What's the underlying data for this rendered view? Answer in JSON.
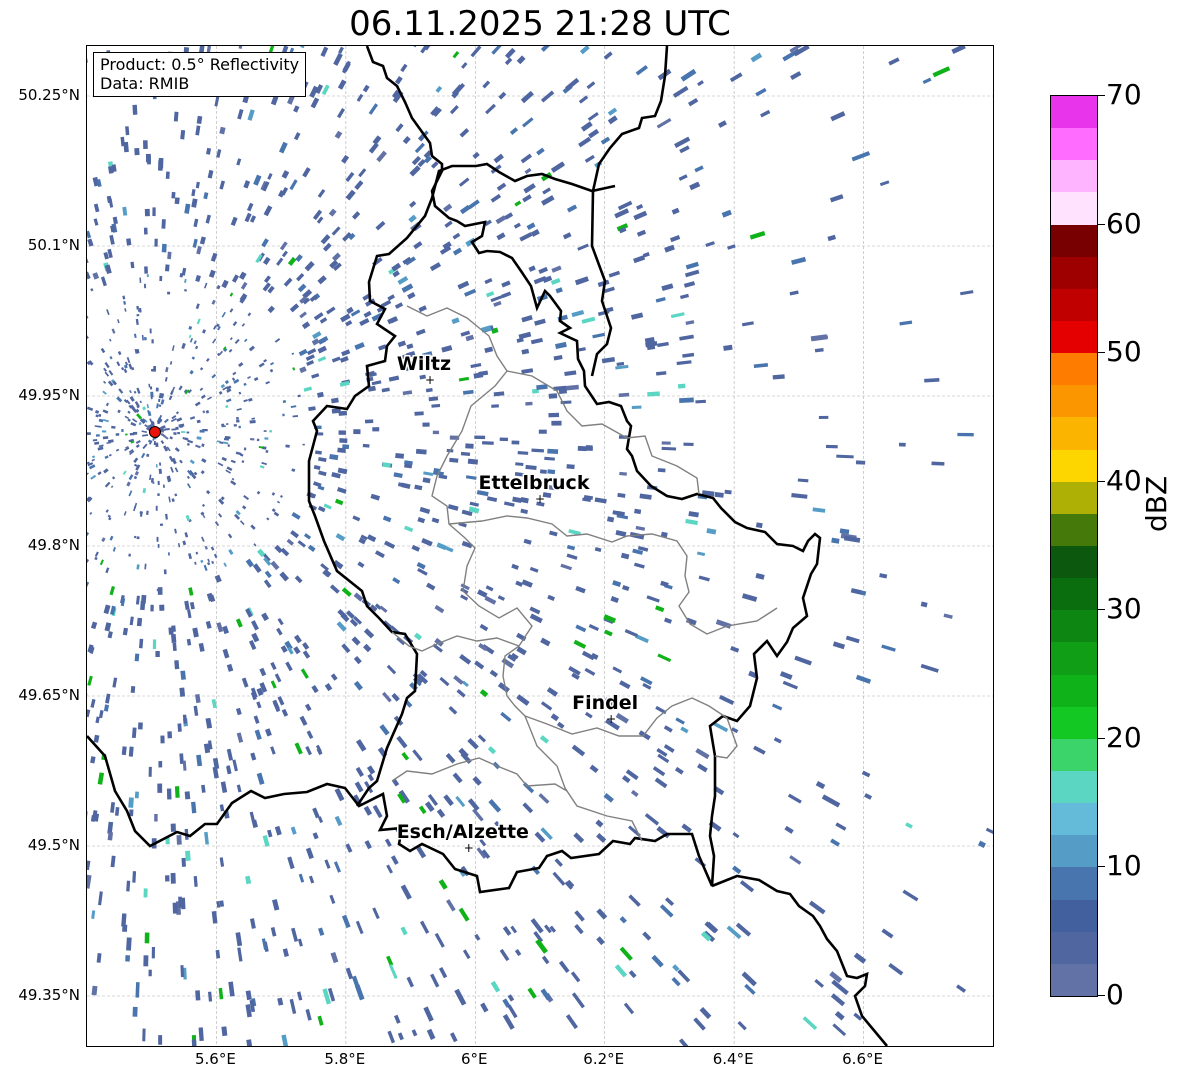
{
  "title": "06.11.2025 21:28 UTC",
  "info_box": {
    "product": "Product: 0.5° Reflectivity",
    "data_source": "Data: RMIB"
  },
  "axes": {
    "lat_ticks": [
      "50.25°N",
      "50.1°N",
      "49.95°N",
      "49.8°N",
      "49.65°N",
      "49.5°N",
      "49.35°N"
    ],
    "lon_ticks": [
      "5.6°E",
      "5.8°E",
      "6°E",
      "6.2°E",
      "6.4°E",
      "6.6°E"
    ]
  },
  "cities": [
    {
      "name": "Wiltz",
      "lon": 5.93,
      "lat": 49.966
    },
    {
      "name": "Ettelbruck",
      "lon": 6.1,
      "lat": 49.847
    },
    {
      "name": "Findel",
      "lon": 6.21,
      "lat": 49.627
    },
    {
      "name": "Esch/Alzette",
      "lon": 5.99,
      "lat": 49.498
    }
  ],
  "radar_site": {
    "lon": 5.505,
    "lat": 49.914,
    "color": "#e8140c"
  },
  "colorbar": {
    "title": "dBZ",
    "min": 0,
    "max": 70,
    "tick_labels": [
      "0",
      "10",
      "20",
      "30",
      "40",
      "50",
      "60",
      "70"
    ],
    "colors": [
      "#6272a6",
      "#5066a0",
      "#42609e",
      "#4875ae",
      "#559dc7",
      "#64bbd9",
      "#5bd6c2",
      "#3bd46a",
      "#13c822",
      "#10b21a",
      "#0f9e16",
      "#0d8612",
      "#0a6e0e",
      "#0b580e",
      "#457a0a",
      "#aeb005",
      "#fdd600",
      "#fbb500",
      "#fb9500",
      "#fe7d00",
      "#e40000",
      "#c00000",
      "#9e0000",
      "#780000",
      "#fee2fe",
      "#feb4fe",
      "#ff6cff",
      "#e835ec"
    ]
  },
  "colors": {
    "border_country": "#000000",
    "border_canton": "#808080",
    "grid": "#b0b0b0",
    "echo_dominant": "#4f69a0",
    "echo_light": "#5fc8d4",
    "echo_green": "#18c22a"
  }
}
